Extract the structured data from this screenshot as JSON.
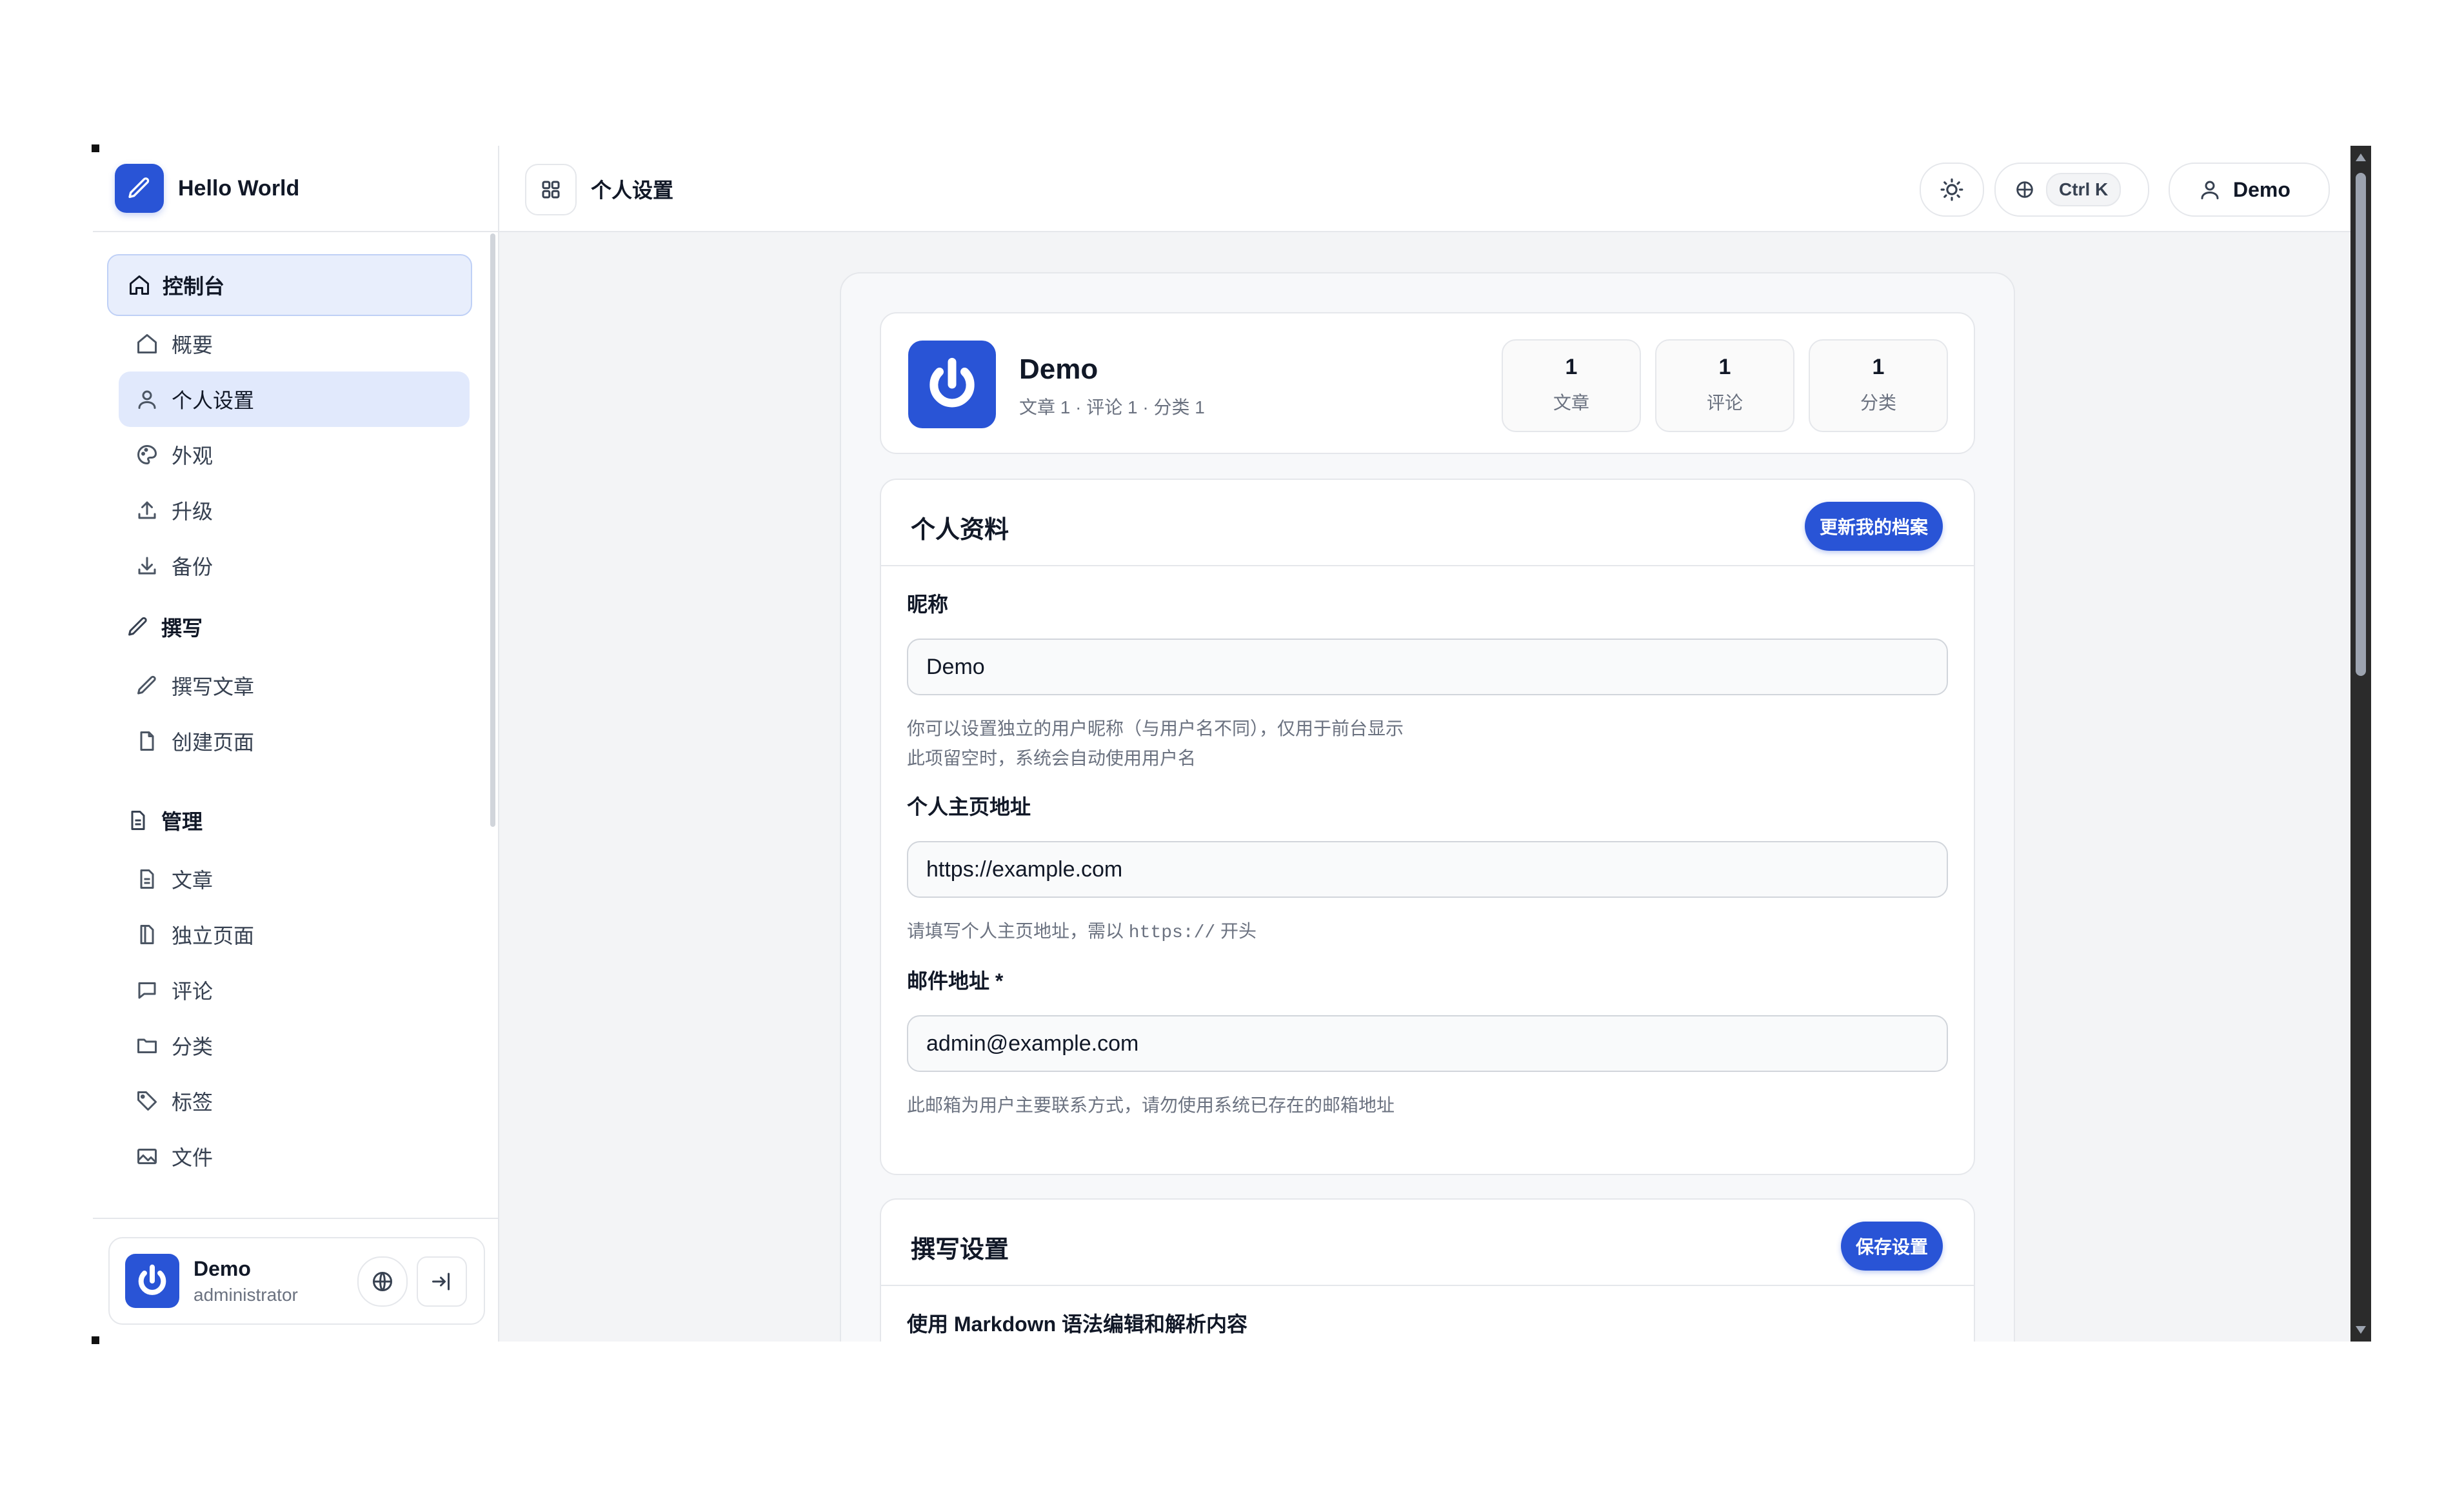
{
  "brand": {
    "name": "Hello World"
  },
  "header": {
    "title": "个人设置",
    "search_shortcut": "Ctrl K",
    "user_label": "Demo"
  },
  "sidebar": {
    "dashboard": "控制台",
    "dashboard_items": [
      {
        "label": "概要",
        "icon": "home-icon"
      },
      {
        "label": "个人设置",
        "icon": "user-icon"
      },
      {
        "label": "外观",
        "icon": "palette-icon"
      },
      {
        "label": "升级",
        "icon": "upload-icon"
      },
      {
        "label": "备份",
        "icon": "download-icon"
      }
    ],
    "write_group": "撰写",
    "write_items": [
      {
        "label": "撰写文章",
        "icon": "pen-icon"
      },
      {
        "label": "创建页面",
        "icon": "file-icon"
      }
    ],
    "manage_group": "管理",
    "manage_items": [
      {
        "label": "文章",
        "icon": "document-icon"
      },
      {
        "label": "独立页面",
        "icon": "pages-icon"
      },
      {
        "label": "评论",
        "icon": "comment-icon"
      },
      {
        "label": "分类",
        "icon": "folder-icon"
      },
      {
        "label": "标签",
        "icon": "tag-icon"
      },
      {
        "label": "文件",
        "icon": "image-icon"
      }
    ],
    "footer": {
      "name": "Demo",
      "role": "administrator"
    }
  },
  "profile": {
    "name": "Demo",
    "summary": "文章 1 · 评论 1 · 分类 1",
    "stats": [
      {
        "value": "1",
        "label": "文章"
      },
      {
        "value": "1",
        "label": "评论"
      },
      {
        "value": "1",
        "label": "分类"
      }
    ]
  },
  "personal": {
    "title": "个人资料",
    "save_label": "更新我的档案",
    "nickname_label": "昵称",
    "nickname_value": "Demo",
    "nickname_help_1": "你可以设置独立的用户昵称（与用户名不同），仅用于前台显示",
    "nickname_help_2": "此项留空时，系统会自动使用用户名",
    "homepage_label": "个人主页地址",
    "homepage_value": "https://example.com",
    "homepage_help_pre": "请填写个人主页地址，需以",
    "homepage_help_code": "https://",
    "homepage_help_post": "开头",
    "email_label": "邮件地址 *",
    "email_value": "admin@example.com",
    "email_help": "此邮箱为用户主要联系方式，请勿使用系统已存在的邮箱地址"
  },
  "compose": {
    "title": "撰写设置",
    "save_label": "保存设置",
    "markdown_label": "使用 Markdown 语法编辑和解析内容"
  },
  "colors": {
    "accent": "#2954d6",
    "active_bg": "#e1e9fc",
    "border": "#e5e7eb"
  }
}
